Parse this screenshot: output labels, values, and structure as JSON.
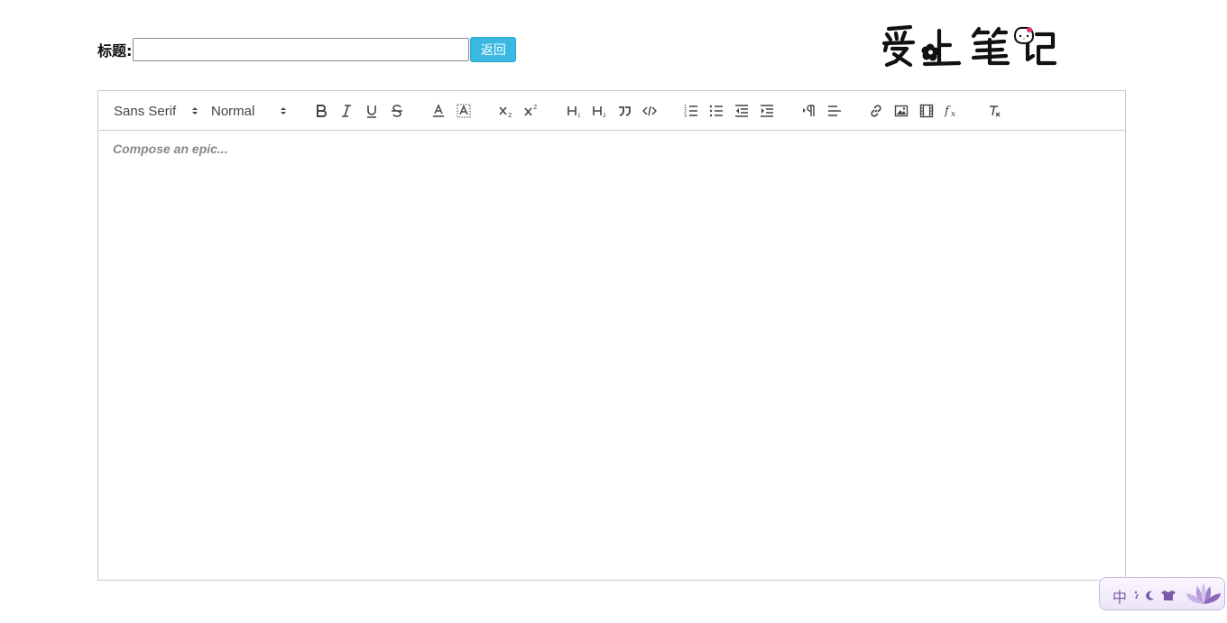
{
  "header": {
    "title_label": "标题:",
    "title_input_value": "",
    "back_button_label": "返回",
    "logo_text": "爱上笔记"
  },
  "toolbar": {
    "font_picker": "Sans Serif",
    "size_picker": "Normal",
    "buttons": [
      "bold-icon",
      "italic-icon",
      "underline-icon",
      "strike-icon",
      "font-color-icon",
      "background-color-icon",
      "subscript-icon",
      "superscript-icon",
      "header1-icon",
      "header2-icon",
      "blockquote-icon",
      "code-block-icon",
      "ordered-list-icon",
      "bullet-list-icon",
      "outdent-icon",
      "indent-icon",
      "rtl-direction-icon",
      "align-icon",
      "link-icon",
      "image-icon",
      "video-icon",
      "formula-icon",
      "clean-format-icon"
    ]
  },
  "editor": {
    "placeholder": "Compose an epic..."
  },
  "ime": {
    "mode_label": "中"
  },
  "colors": {
    "button_blue": "#3ab8e2",
    "border_gray": "#cccccc"
  }
}
